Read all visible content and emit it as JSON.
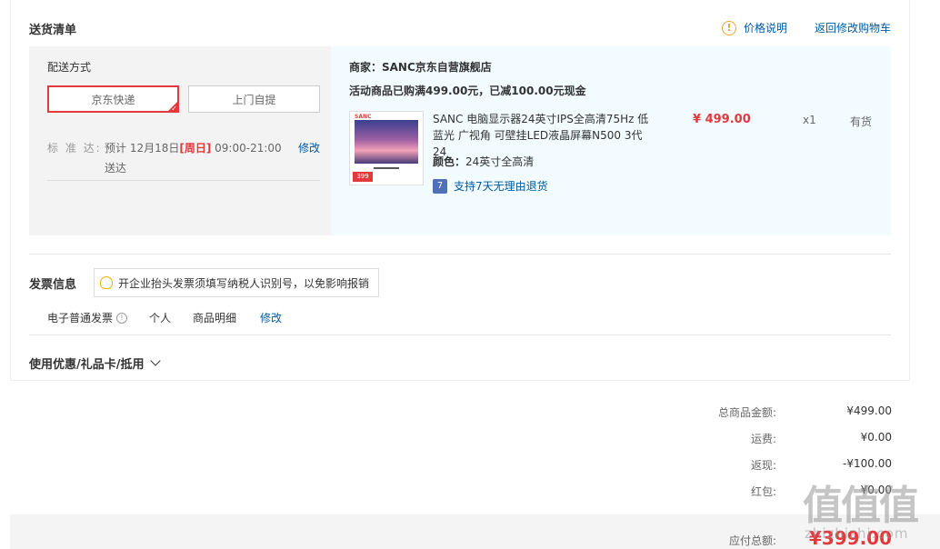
{
  "header": {
    "title": "送货清单",
    "price_note": "价格说明",
    "back_to_cart": "返回修改购物车"
  },
  "shipping": {
    "label": "配送方式",
    "options": [
      "京东快递",
      "上门自提"
    ],
    "selected": "京东快递",
    "std_label": "标 准 达:",
    "std_text_prefix": "预计 12月18日",
    "std_day": "[周日]",
    "std_text_suffix": " 09:00-21:00 送达",
    "edit": "修改"
  },
  "shop": {
    "merchant": "商家：SANC京东自营旗舰店",
    "promo": "活动商品已购满499.00元，已减100.00元现金",
    "product": {
      "name": "SANC 电脑显示器24英寸IPS全高清75Hz 低蓝光 广视角 可壁挂LED液晶屏幕N500 3代 24",
      "color_label": "颜色：",
      "color_value": "24英寸全高清",
      "return_policy": "支持7天无理由退货",
      "return_badge": "7",
      "price": "¥ 499.00",
      "qty": "x1",
      "stock": "有货",
      "thumb_brand": "SANC",
      "thumb_price": "399"
    }
  },
  "invoice": {
    "title": "发票信息",
    "tip": "开企业抬头发票须填写纳税人识别号，以免影响报销",
    "type": "电子普通发票",
    "holder": "个人",
    "content": "商品明细",
    "edit": "修改"
  },
  "coupon": {
    "label": "使用优惠/礼品卡/抵用"
  },
  "summary": {
    "rows": [
      {
        "label": "总商品金额:",
        "value": "¥499.00"
      },
      {
        "label": "运费:",
        "value": "¥0.00"
      },
      {
        "label": "返现:",
        "value": "-¥100.00"
      },
      {
        "label": "红包:",
        "value": "¥0.00"
      }
    ],
    "total_label": "应付总额:",
    "total_value": "¥399.00"
  },
  "watermark": {
    "main": "值值值",
    "sub": "zhizhizhi.com"
  },
  "colors": {
    "accent": "#e4393c",
    "link": "#005aa0",
    "shop_bg": "#f2fbff"
  }
}
